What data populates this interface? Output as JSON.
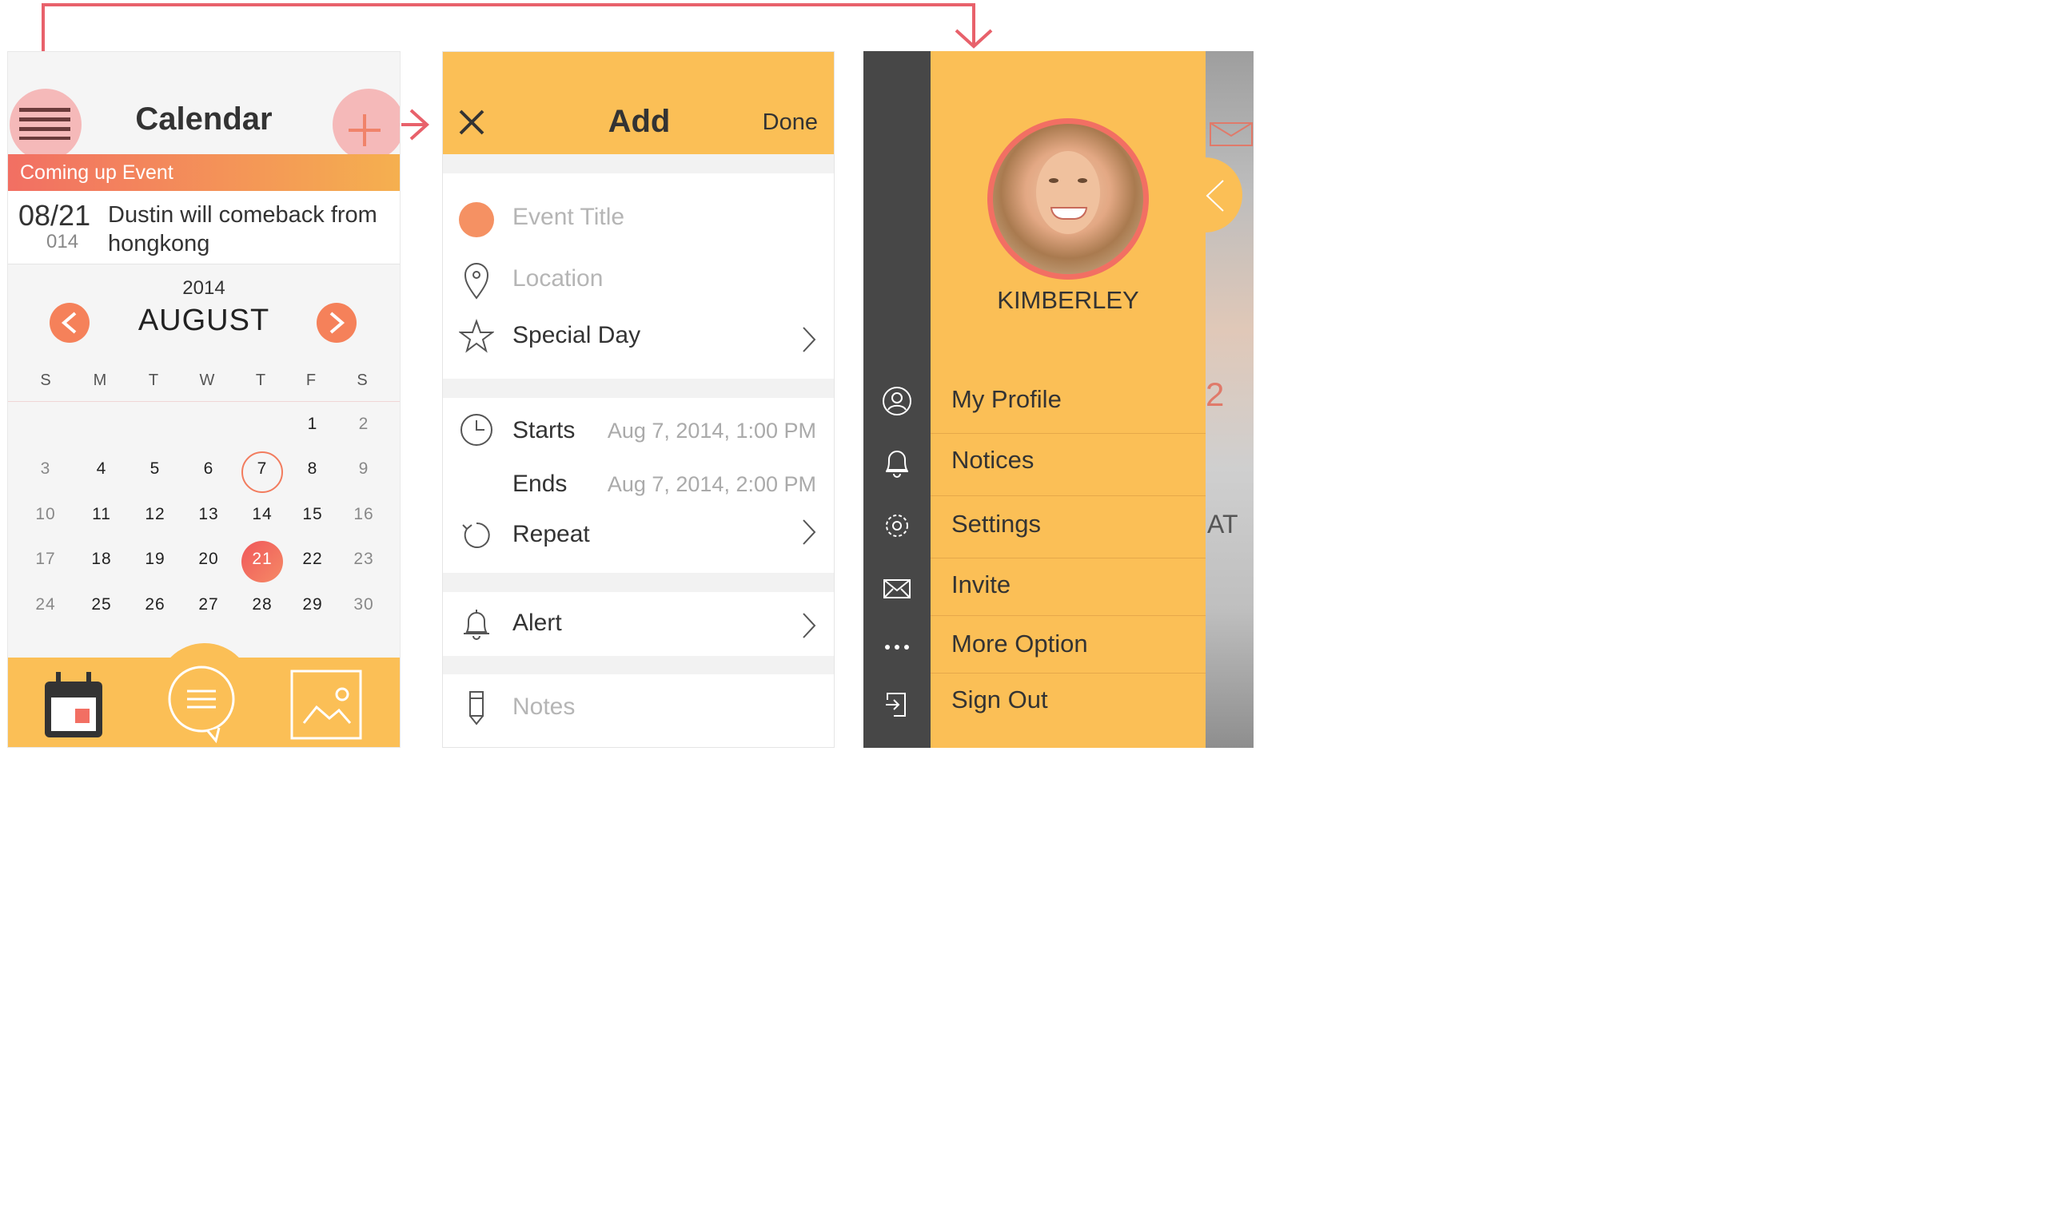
{
  "calendar": {
    "title": "Calendar",
    "coming_up_label": "Coming up Event",
    "event": {
      "date": "08/21",
      "year": "014",
      "text": "Dustin will comeback from hongkong"
    },
    "year": "2014",
    "month": "AUGUST",
    "weekdays": [
      "S",
      "M",
      "T",
      "W",
      "T",
      "F",
      "S"
    ],
    "weeks": [
      [
        "",
        "",
        "",
        "",
        "",
        "1",
        "2"
      ],
      [
        "3",
        "4",
        "5",
        "6",
        "7",
        "8",
        "9"
      ],
      [
        "10",
        "11",
        "12",
        "13",
        "14",
        "15",
        "16"
      ],
      [
        "17",
        "18",
        "19",
        "20",
        "21",
        "22",
        "23"
      ],
      [
        "24",
        "25",
        "26",
        "27",
        "28",
        "29",
        "30"
      ]
    ],
    "today": "7",
    "selected": "21"
  },
  "add": {
    "title": "Add",
    "done_label": "Done",
    "event_title_placeholder": "Event Title",
    "location_placeholder": "Location",
    "special_day_label": "Special Day",
    "starts_label": "Starts",
    "starts_value": "Aug 7, 2014, 1:00 PM",
    "ends_label": "Ends",
    "ends_value": "Aug 7, 2014, 2:00 PM",
    "repeat_label": "Repeat",
    "alert_label": "Alert",
    "notes_placeholder": "Notes"
  },
  "menu": {
    "user_name": "KIMBERLEY",
    "items": [
      "My Profile",
      "Notices",
      "Settings",
      "Invite",
      "More Option",
      "Sign Out"
    ],
    "peek_number": "2",
    "peek_text": "AT"
  },
  "colors": {
    "accent_yellow": "#fbbf56",
    "accent_orange": "#f5815a",
    "accent_red": "#f26f63",
    "connector": "#e8616b"
  }
}
